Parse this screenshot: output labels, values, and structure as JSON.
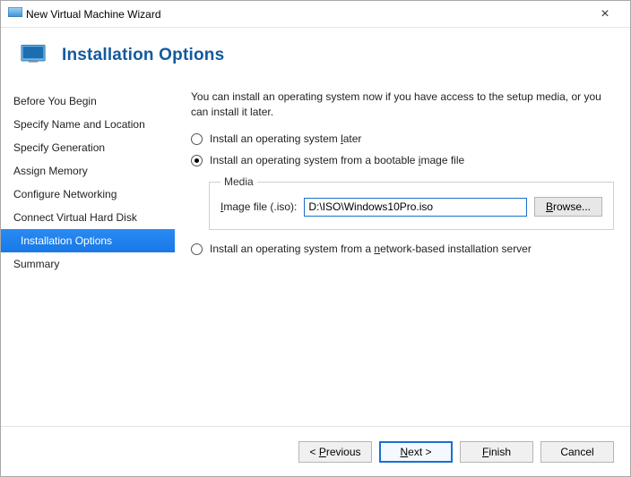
{
  "window": {
    "title": "New Virtual Machine Wizard"
  },
  "header": {
    "title": "Installation Options"
  },
  "sidebar": {
    "items": [
      {
        "label": "Before You Begin"
      },
      {
        "label": "Specify Name and Location"
      },
      {
        "label": "Specify Generation"
      },
      {
        "label": "Assign Memory"
      },
      {
        "label": "Configure Networking"
      },
      {
        "label": "Connect Virtual Hard Disk"
      },
      {
        "label": "Installation Options"
      },
      {
        "label": "Summary"
      }
    ],
    "active_index": 6
  },
  "content": {
    "description": "You can install an operating system now if you have access to the setup media, or you can install it later.",
    "options": {
      "later_pre": "Install an operating system ",
      "later_u": "l",
      "later_post": "ater",
      "image_pre": "Install an operating system from a bootable ",
      "image_u": "i",
      "image_post": "mage file",
      "network_pre": "Install an operating system from a ",
      "network_u": "n",
      "network_post": "etwork-based installation server"
    },
    "media": {
      "legend": "Media",
      "label_u": "I",
      "label_post": "mage file (.iso):",
      "value": "D:\\ISO\\Windows10Pro.iso",
      "browse_u": "B",
      "browse_post": "rowse..."
    }
  },
  "footer": {
    "previous_pre": "< ",
    "previous_u": "P",
    "previous_post": "revious",
    "next_u": "N",
    "next_post": "ext >",
    "finish_u": "F",
    "finish_post": "inish",
    "cancel": "Cancel"
  }
}
